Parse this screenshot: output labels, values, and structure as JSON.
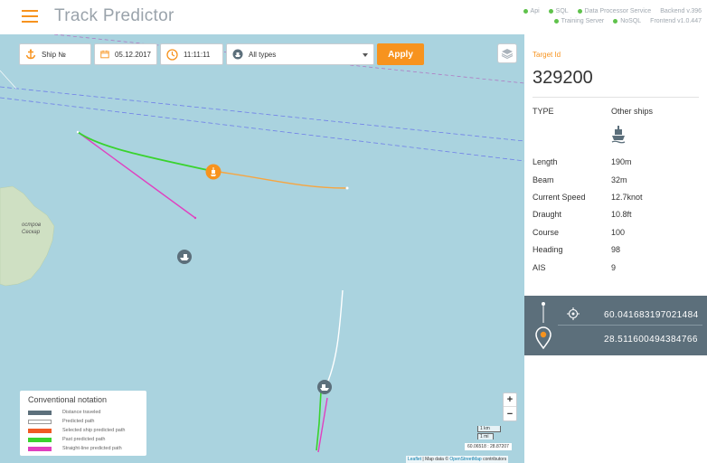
{
  "header": {
    "title": "Track Predictor",
    "services_row1": [
      "Api",
      "SQL",
      "Data Processor Service"
    ],
    "backend_version": "Backend v.396",
    "services_row2": [
      "Training Server",
      "NoSQL"
    ],
    "frontend_version": "Frontend v1.0.447",
    "status_color": "#5fc24b"
  },
  "toolbar": {
    "ship_placeholder": "Ship №",
    "date": "05.12.2017",
    "time": "11:11:11",
    "type_selected": "All types",
    "apply_label": "Apply"
  },
  "map": {
    "island_label_1": "остров",
    "island_label_2": "Сескар",
    "zoom_in": "+",
    "zoom_out": "−",
    "scale_km": "1 km",
    "scale_mi": "1 mi",
    "cursor_coords": "60.06518 : 28.87207",
    "attrib_leaflet": "Leaflet",
    "attrib_sep": " | Map data © ",
    "attrib_osm": "OpenStreetMap",
    "attrib_end": " contributors"
  },
  "legend": {
    "title": "Conventional notation",
    "items": [
      {
        "label": "Distance traveled",
        "color": "#5c6f7b"
      },
      {
        "label": "Predicted path",
        "color": "#ffffff"
      },
      {
        "label": "Selected ship predicted path",
        "color": "#f15a24"
      },
      {
        "label": "Past predicted path",
        "color": "#39d32e"
      },
      {
        "label": "Straight-line predicted path",
        "color": "#e040c0"
      }
    ]
  },
  "panel": {
    "target_label": "Target Id",
    "target_id": "329200",
    "type_label": "TYPE",
    "type_value": "Other ships",
    "details": [
      {
        "label": "Length",
        "value": "190m"
      },
      {
        "label": "Beam",
        "value": "32m"
      },
      {
        "label": "Current Speed",
        "value": "12.7knot"
      },
      {
        "label": "Draught",
        "value": "10.8ft"
      },
      {
        "label": "Course",
        "value": "100"
      },
      {
        "label": "Heading",
        "value": "98"
      },
      {
        "label": "AIS",
        "value": "9"
      }
    ],
    "latitude": "60.041683197021484",
    "longitude": "28.511600494384766"
  },
  "colors": {
    "accent": "#f7931e",
    "sea": "#aad3df",
    "land": "#cfe0c3",
    "coord_box": "#5c6f7b"
  }
}
